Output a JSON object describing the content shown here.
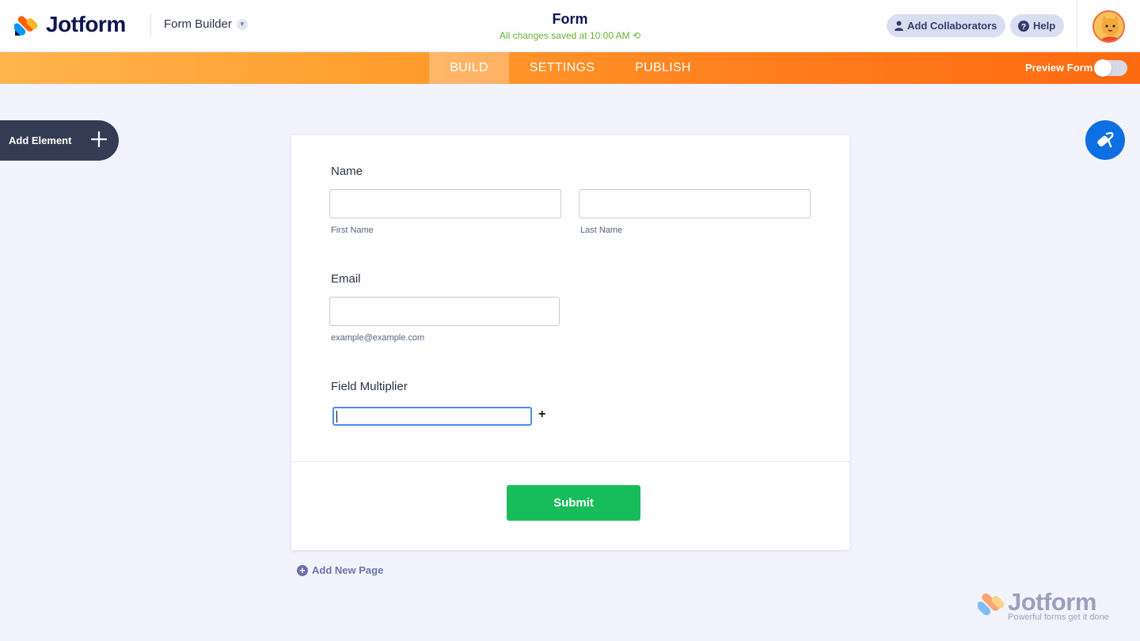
{
  "header": {
    "logo_text": "Jotform",
    "builder_label": "Form Builder",
    "form_title": "Form",
    "saved_status": "All changes saved at 10:00 AM",
    "collaborators_label": "Add Collaborators",
    "help_label": "Help"
  },
  "nav": {
    "tabs": [
      {
        "label": "BUILD",
        "active": true
      },
      {
        "label": "SETTINGS",
        "active": false
      },
      {
        "label": "PUBLISH",
        "active": false
      }
    ],
    "preview_label": "Preview Form",
    "preview_enabled": false
  },
  "sidebar": {
    "add_element_label": "Add Element"
  },
  "form": {
    "name_label": "Name",
    "first_name_sublabel": "First Name",
    "last_name_sublabel": "Last Name",
    "email_label": "Email",
    "email_sublabel": "example@example.com",
    "multiplier_label": "Field Multiplier",
    "multiplier_add": "+",
    "submit_label": "Submit"
  },
  "footer": {
    "add_page_label": "Add New Page",
    "watermark_text": "Jotform",
    "watermark_tagline": "Powerful forms get it done"
  },
  "colors": {
    "brand_navy": "#0a1551",
    "nav_orange": "#ff7b1c",
    "submit_green": "#18bd5b",
    "saved_green": "#64b332",
    "paint_blue": "#0c6fe2"
  }
}
